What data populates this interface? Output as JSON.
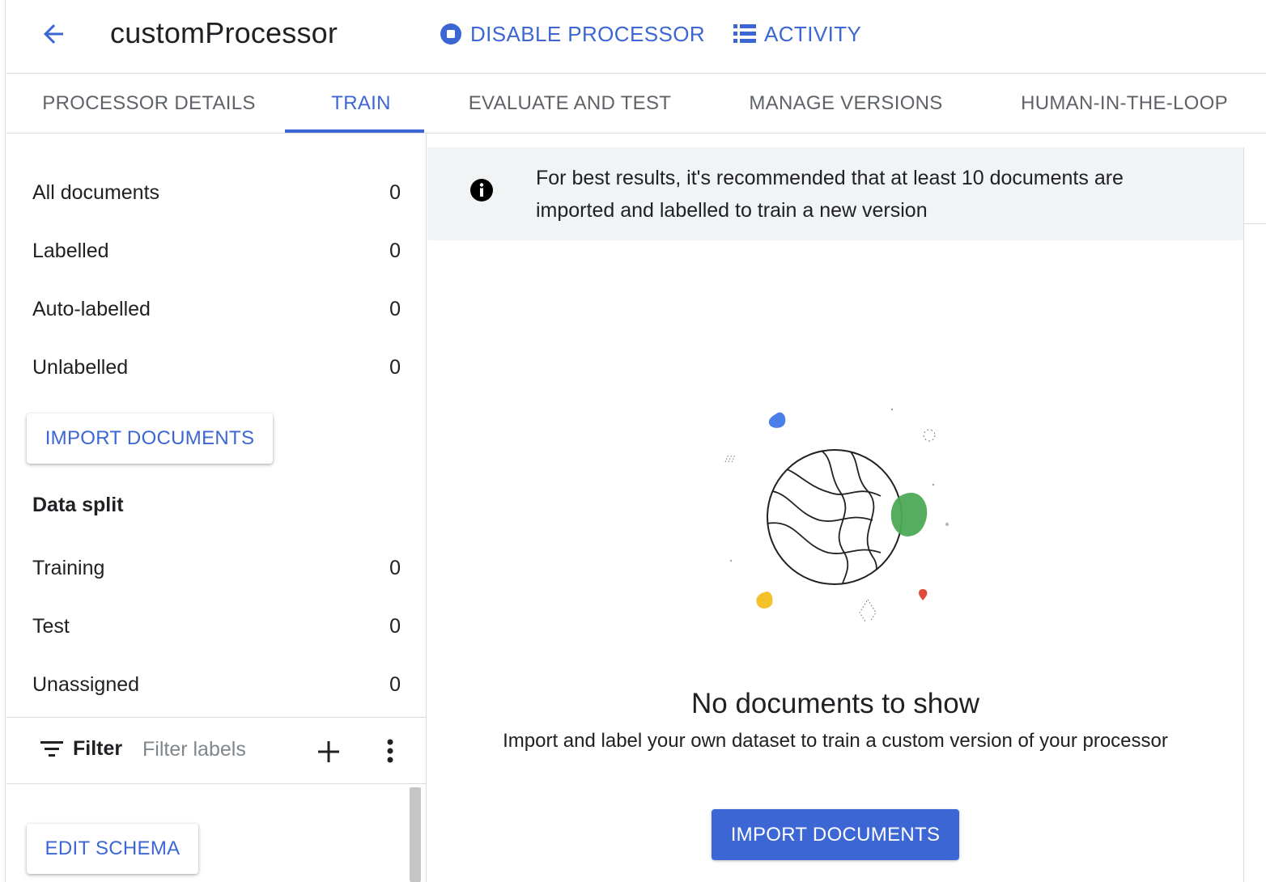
{
  "header": {
    "title": "customProcessor",
    "disable_label": "DISABLE PROCESSOR",
    "activity_label": "ACTIVITY"
  },
  "tabs": [
    {
      "label": "PROCESSOR DETAILS"
    },
    {
      "label": "TRAIN",
      "active": true
    },
    {
      "label": "EVALUATE AND TEST"
    },
    {
      "label": "MANAGE VERSIONS"
    },
    {
      "label": "HUMAN-IN-THE-LOOP"
    }
  ],
  "sidebar": {
    "stats": [
      {
        "label": "All documents",
        "count": "0"
      },
      {
        "label": "Labelled",
        "count": "0"
      },
      {
        "label": "Auto-labelled",
        "count": "0"
      },
      {
        "label": "Unlabelled",
        "count": "0"
      }
    ],
    "import_label": "IMPORT DOCUMENTS",
    "data_split_title": "Data split",
    "split": [
      {
        "label": "Training",
        "count": "0"
      },
      {
        "label": "Test",
        "count": "0"
      },
      {
        "label": "Unassigned",
        "count": "0"
      }
    ],
    "filter_label": "Filter",
    "filter_placeholder": "Filter labels",
    "edit_schema_label": "EDIT SCHEMA"
  },
  "main": {
    "banner_text": "For best results, it's recommended that at least 10 documents are imported and labelled to train a new version",
    "empty_title": "No documents to show",
    "empty_subtitle": "Import and label your own dataset to train a custom version of your processor",
    "import_label": "IMPORT DOCUMENTS"
  },
  "colors": {
    "accent": "#3c66d4",
    "illustration_blue": "#4a7ee8",
    "illustration_green": "#4caa57",
    "illustration_yellow": "#f3c12a",
    "illustration_red": "#e04c3b"
  }
}
